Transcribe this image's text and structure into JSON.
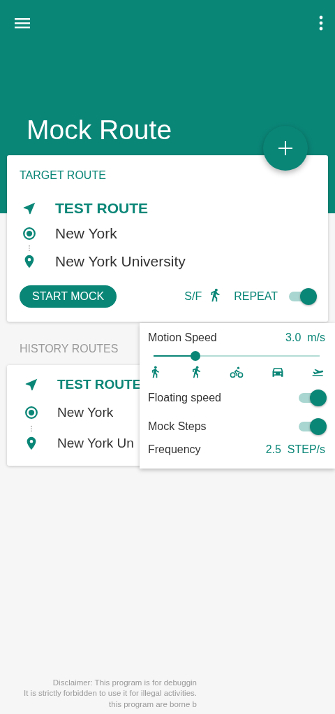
{
  "app_bar": {
    "title": "Mock Route"
  },
  "target_route": {
    "heading": "TARGET ROUTE",
    "route_name": "TEST ROUTE",
    "start": "New York",
    "destination": "New York University",
    "start_button": "START MOCK",
    "sf_label": "S/F",
    "repeat_label": "REPEAT",
    "repeat_on": true
  },
  "history": {
    "heading": "HISTORY ROUTES",
    "routes": [
      {
        "route_name": "TEST ROUTE",
        "start": "New York",
        "destination": "New York Un"
      }
    ]
  },
  "speed_panel": {
    "motion_label": "Motion Speed",
    "speed_value": "3.0",
    "speed_unit": "m/s",
    "level": 0.25,
    "floating_label": "Floating speed",
    "floating_on": true,
    "steps_label": "Mock Steps",
    "steps_on": true,
    "frequency_label": "Frequency",
    "frequency_value": "2.5",
    "frequency_unit": "STEP/s"
  },
  "disclaimer": [
    "Disclaimer: This program is for debuggin",
    "It is strictly forbidden to use it for illegal activities.",
    "this program are borne b"
  ]
}
